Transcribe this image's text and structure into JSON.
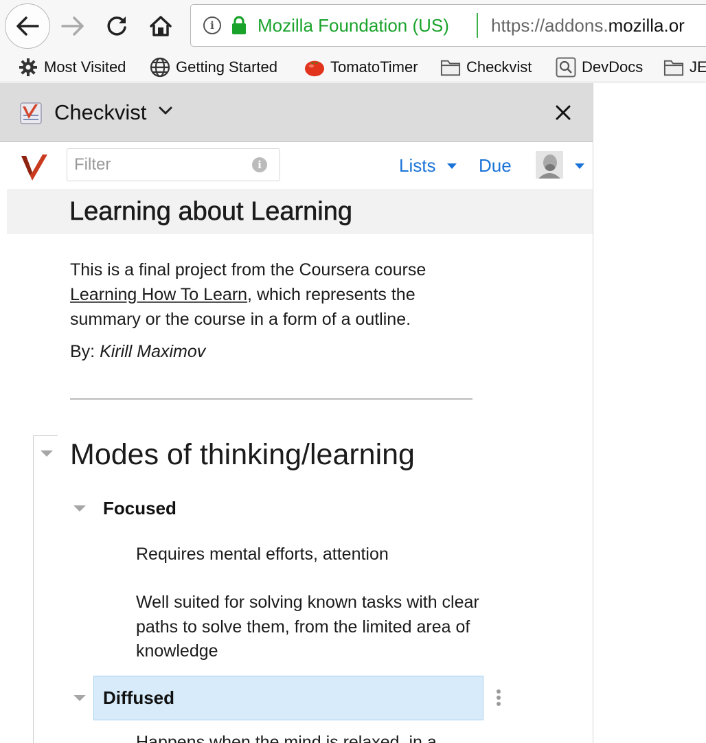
{
  "browser": {
    "identity": "Mozilla Foundation (US)",
    "url_prefix": "https://addons.",
    "url_domain": "mozilla.or",
    "bookmarks": [
      {
        "label": "Most Visited",
        "icon": "gear-icon"
      },
      {
        "label": "Getting Started",
        "icon": "globe-icon"
      },
      {
        "label": "TomatoTimer",
        "icon": "tomato-icon"
      },
      {
        "label": "Checkvist",
        "icon": "folder-icon"
      },
      {
        "label": "DevDocs",
        "icon": "search-box-icon"
      },
      {
        "label": "JE",
        "icon": "folder-icon"
      }
    ]
  },
  "sidebar": {
    "title": "Checkvist"
  },
  "app": {
    "filter_placeholder": "Filter",
    "lists_label": "Lists",
    "due_label": "Due",
    "accent_color": "#1a73d8"
  },
  "document": {
    "title": "Learning about Learning",
    "description_before": "This is a final project from the Coursera course ",
    "course_link": "Learning How To Learn",
    "description_after": ", which represents the summary or the course in a form of a outline.",
    "by_label": "By: ",
    "author": "Kirill Maximov"
  },
  "outline": {
    "heading": "Modes of thinking/learning",
    "focused": {
      "label": "Focused",
      "notes": [
        "Requires mental efforts, attention",
        "Well suited for solving known tasks with clear paths to solve them, from the limited area of knowledge"
      ]
    },
    "diffused": {
      "label": "Diffused",
      "note_partial": "Happens when the mind is relaxed, in a"
    },
    "selected_color": "#d7ebfa"
  }
}
